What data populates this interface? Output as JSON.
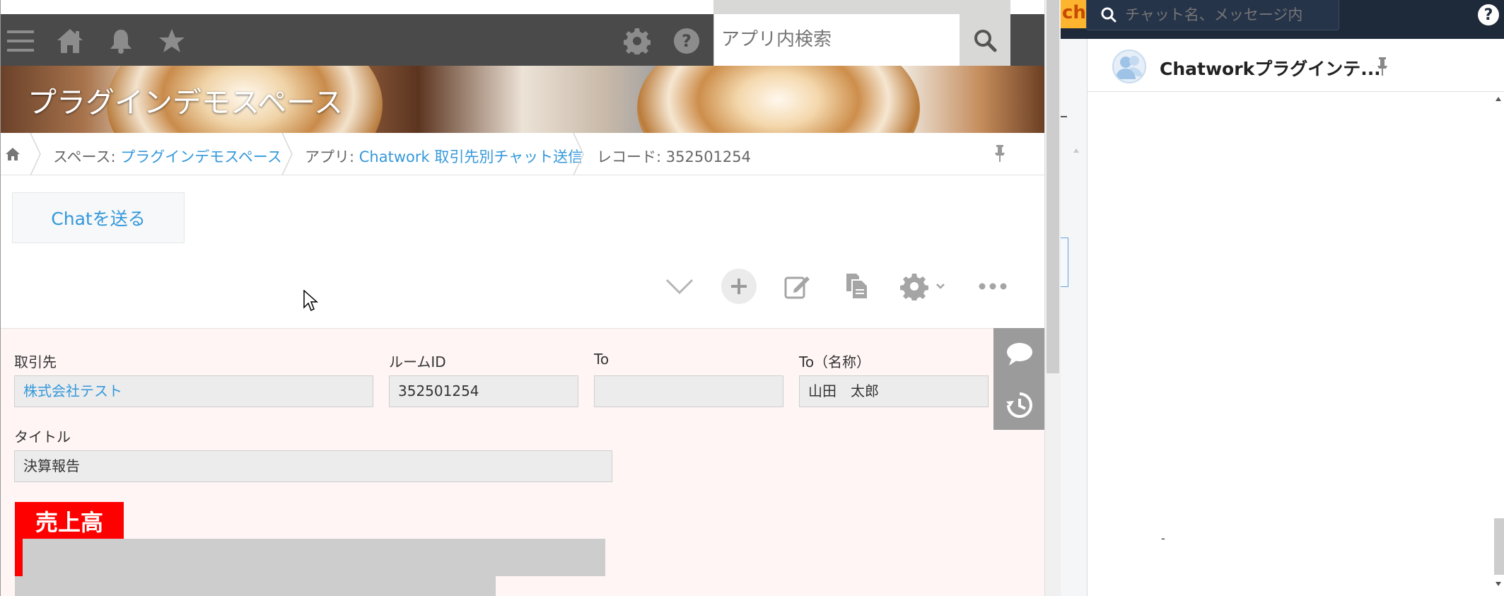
{
  "kintone": {
    "header": {
      "search_placeholder": "アプリ内検索"
    },
    "space_title": "プラグインデモスペース",
    "breadcrumb": {
      "space_prefix": "スペース: ",
      "space_link": "プラグインデモスペース",
      "app_prefix": "アプリ: ",
      "app_link": "Chatwork 取引先別チャット送信",
      "record_text": "レコード: 352501254"
    },
    "chat_button_label": "Chatを送る",
    "form": {
      "fields": [
        {
          "label": "取引先",
          "value": "株式会社テスト"
        },
        {
          "label": "ルームID",
          "value": "352501254"
        },
        {
          "label": "To",
          "value": ""
        },
        {
          "label": "To（名称）",
          "value": "山田　太郎"
        },
        {
          "label": "タイトル",
          "value": "決算報告"
        }
      ],
      "section_label": "売上高"
    }
  },
  "chatwork": {
    "logo_text": "ch",
    "search_placeholder": "チャット名、メッセージ内",
    "room_name": "Chatworkプラグインテ...",
    "dash_text": "-",
    "help_label": "?"
  }
}
